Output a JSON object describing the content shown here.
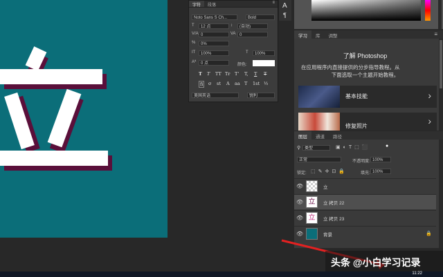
{
  "character_panel": {
    "tabs": [
      "字符",
      "段落"
    ],
    "font_family": "Noto Sans S Ch...",
    "font_style": "Bold",
    "font_size": "12 点",
    "leading": "(自动)",
    "kerning": "0",
    "tracking": "0",
    "scale_vertical_percent": "0%",
    "scale_horizontal": "100%",
    "scale_vertical": "100%",
    "baseline_shift": "0 点",
    "color_label": "颜色:",
    "typestyle_buttons": [
      "T",
      "T",
      "TT",
      "Tr",
      "T'",
      "T,",
      "T",
      "T"
    ],
    "opentype_buttons": [
      "fi",
      "σ",
      "st",
      "A",
      "aa",
      "T",
      "1st",
      "½"
    ],
    "language": "美国英语",
    "antialias": "锐利"
  },
  "tool_strip": {
    "items": [
      "A",
      "¶"
    ]
  },
  "learn_panel": {
    "tabs": [
      "学习",
      "库",
      "调整"
    ],
    "title": "了解 Photoshop",
    "description_line1": "在应用程序内直接提供的分步指导教程。从",
    "description_line2": "下面选取一个主题开始教程。",
    "tutorials": [
      {
        "name": "基本技能"
      },
      {
        "name": "修复照片"
      }
    ]
  },
  "layers_panel": {
    "tabs": [
      "图层",
      "通道",
      "路径"
    ],
    "filter_kind": "类型",
    "blend_mode": "正常",
    "opacity_label": "不透明度:",
    "opacity_value": "100%",
    "lock_label": "锁定:",
    "fill_label": "填充:",
    "fill_value": "100%",
    "layers": [
      {
        "name": "立",
        "selected": false
      },
      {
        "name": "立 拷贝 22",
        "selected": true
      },
      {
        "name": "立 拷贝 23",
        "selected": false
      },
      {
        "name": "背景",
        "selected": false
      }
    ]
  },
  "watermark": {
    "text": "头条 @小白学习记录"
  },
  "taskbar": {
    "clock": "11:22"
  },
  "colors": {
    "canvas": "#0b6e79",
    "glyph": "#ffffff",
    "glyph_shadow": "#5a0f3a",
    "ui_bg": "#282828",
    "arrow": "#e32121"
  }
}
